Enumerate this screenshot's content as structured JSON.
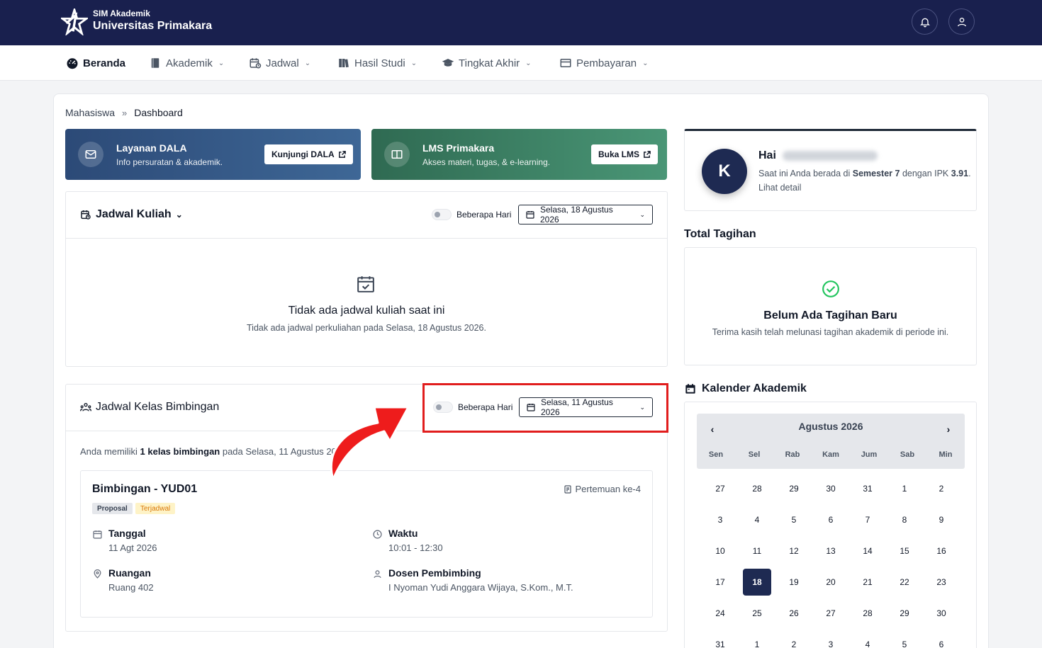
{
  "header": {
    "app_small": "SIM Akademik",
    "app_big": "Universitas Primakara",
    "icons": [
      "bell-icon",
      "user-icon"
    ]
  },
  "nav": {
    "items": [
      {
        "label": "Beranda",
        "icon": "dashboard-icon",
        "active": true
      },
      {
        "label": "Akademik",
        "icon": "book-icon"
      },
      {
        "label": "Jadwal",
        "icon": "calendar-icon"
      },
      {
        "label": "Hasil Studi",
        "icon": "books-icon"
      },
      {
        "label": "Tingkat Akhir",
        "icon": "graduation-cap-icon"
      },
      {
        "label": "Pembayaran",
        "icon": "wallet-icon"
      }
    ]
  },
  "breadcrumb": {
    "parent": "Mahasiswa",
    "separator": "»",
    "current": "Dashboard"
  },
  "promo": {
    "dala": {
      "title": "Layanan DALA",
      "subtitle": "Info persuratan & akademik.",
      "button": "Kunjungi DALA"
    },
    "lms": {
      "title": "LMS Primakara",
      "subtitle": "Akses materi, tugas, & e-learning.",
      "button": "Buka LMS"
    }
  },
  "jadwal_kuliah": {
    "title": "Jadwal Kuliah",
    "toggle_label": "Beberapa Hari",
    "date": "Selasa, 18 Agustus 2026",
    "empty_title": "Tidak ada jadwal kuliah saat ini",
    "empty_sub": "Tidak ada jadwal perkuliahan pada Selasa, 18 Agustus 2026."
  },
  "bimbingan": {
    "title": "Jadwal Kelas Bimbingan",
    "toggle_label": "Beberapa Hari",
    "date": "Selasa, 11 Agustus 2026",
    "info_pre": "Anda memiliki ",
    "info_bold": "1 kelas bimbingan",
    "info_post": " pada Selasa, 11 Agustus 2026",
    "card": {
      "title": "Bimbingan - YUD01",
      "pertemuan": "Pertemuan ke-4",
      "badge1": "Proposal",
      "badge2": "Terjadwal",
      "tanggal_label": "Tanggal",
      "tanggal_value": "11 Agt 2026",
      "waktu_label": "Waktu",
      "waktu_value": "10:01 - 12:30",
      "ruangan_label": "Ruangan",
      "ruangan_value": "Ruang 402",
      "dosen_label": "Dosen Pembimbing",
      "dosen_value": "I Nyoman Yudi Anggara Wijaya, S.Kom., M.T."
    }
  },
  "profile": {
    "initial": "K",
    "greeting": "Hai",
    "text_pre": "Saat ini Anda berada di ",
    "semester": "Semester 7",
    "text_mid": " dengan IPK ",
    "ipk": "3.91",
    "text_post": ". Lihat detail"
  },
  "tagihan": {
    "section_title": "Total Tagihan",
    "title": "Belum Ada Tagihan Baru",
    "subtitle": "Terima kasih telah melunasi tagihan akademik di periode ini."
  },
  "kalender": {
    "section_title": "Kalender Akademik",
    "month": "Agustus 2026",
    "days_of_week": [
      "Sen",
      "Sel",
      "Rab",
      "Kam",
      "Jum",
      "Sab",
      "Min"
    ],
    "weeks": [
      [
        "27",
        "28",
        "29",
        "30",
        "31",
        "1",
        "2"
      ],
      [
        "3",
        "4",
        "5",
        "6",
        "7",
        "8",
        "9"
      ],
      [
        "10",
        "11",
        "12",
        "13",
        "14",
        "15",
        "16"
      ],
      [
        "17",
        "18",
        "19",
        "20",
        "21",
        "22",
        "23"
      ],
      [
        "24",
        "25",
        "26",
        "27",
        "28",
        "29",
        "30"
      ],
      [
        "31",
        "1",
        "2",
        "3",
        "4",
        "5",
        "6"
      ]
    ],
    "today": "18"
  },
  "colors": {
    "navy": "#19204e",
    "highlight": "#e11d1d",
    "success": "#22c55e",
    "amber": "#d97706"
  }
}
